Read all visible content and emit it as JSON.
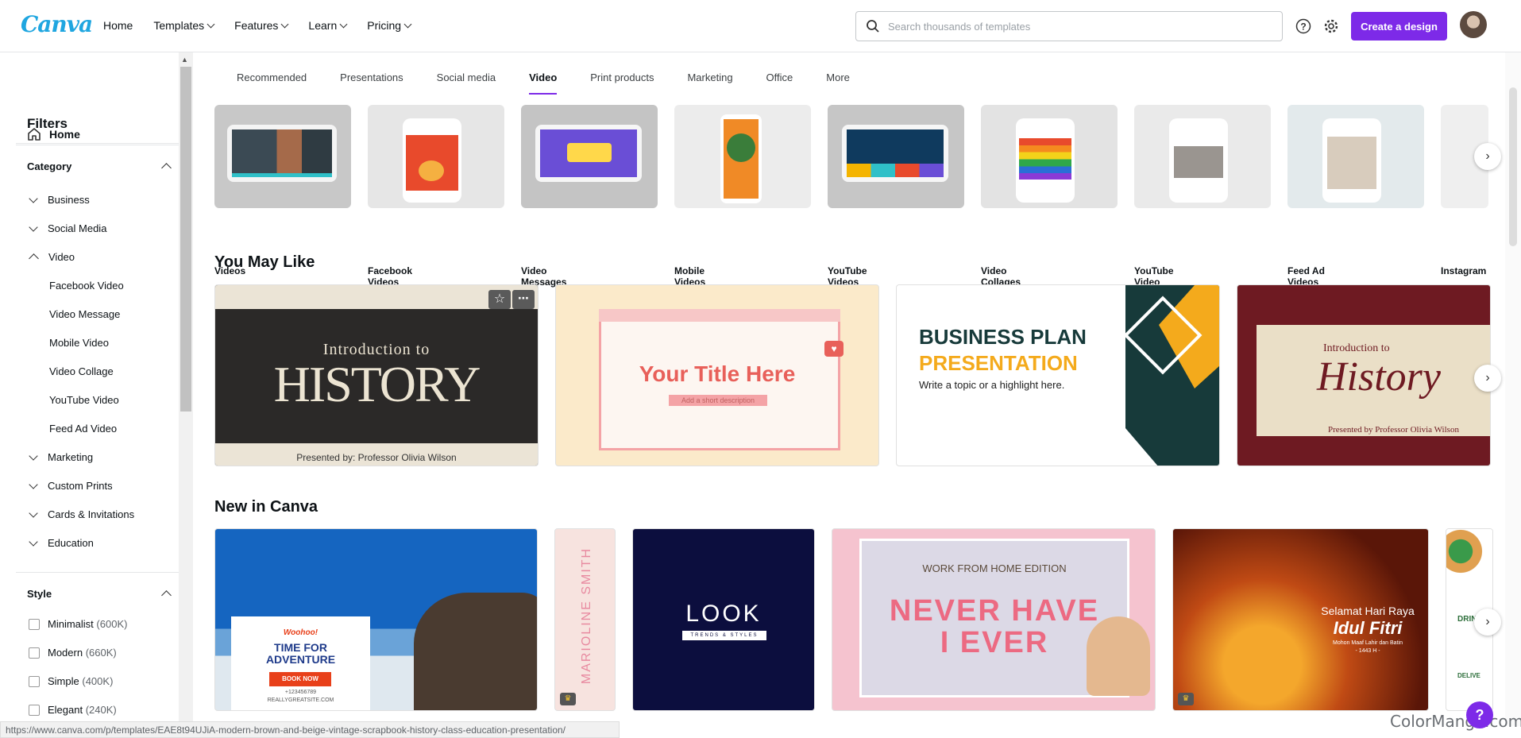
{
  "app": {
    "logo": "Canva"
  },
  "nav": {
    "home": "Home",
    "templates": "Templates",
    "features": "Features",
    "learn": "Learn",
    "pricing": "Pricing"
  },
  "search": {
    "placeholder": "Search thousands of templates"
  },
  "header": {
    "create_label": "Create a design"
  },
  "sidebar": {
    "home": "Home",
    "filters": "Filters",
    "category_title": "Category",
    "categories": [
      "Business",
      "Social Media",
      "Video"
    ],
    "video_sub": [
      "Facebook Video",
      "Video Message",
      "Mobile Video",
      "Video Collage",
      "YouTube Video",
      "Feed Ad Video"
    ],
    "more_categories": [
      "Marketing",
      "Custom Prints",
      "Cards & Invitations",
      "Education"
    ],
    "style_title": "Style",
    "styles": [
      {
        "name": "Minimalist",
        "count": "(600K)"
      },
      {
        "name": "Modern",
        "count": "(660K)"
      },
      {
        "name": "Simple",
        "count": "(400K)"
      },
      {
        "name": "Elegant",
        "count": "(240K)"
      }
    ]
  },
  "tabs": [
    "Recommended",
    "Presentations",
    "Social media",
    "Video",
    "Print products",
    "Marketing",
    "Office",
    "More"
  ],
  "active_tab": "Video",
  "video_types": [
    "Videos",
    "Facebook Videos",
    "Video Messages",
    "Mobile Videos",
    "YouTube Videos",
    "Video Collages",
    "YouTube Video Ads",
    "Feed Ad Videos (Portrait)",
    "Instagram"
  ],
  "you_may_like": {
    "title": "You May Like",
    "card1": {
      "line1": "Introduction to",
      "line2": "HISTORY",
      "byline": "Presented by: Professor Olivia Wilson"
    },
    "card2": {
      "title": "Your Title Here",
      "subtitle": "Add a short description"
    },
    "card3": {
      "line1": "BUSINESS PLAN",
      "line2": "PRESENTATION",
      "line3": "Write a topic or a highlight here."
    },
    "card4": {
      "line1": "Introduction to",
      "line2": "History",
      "byline": "Presented by Professor Olivia Wilson"
    }
  },
  "new_in_canva": {
    "title": "New in Canva",
    "card1": {
      "woohoo": "Woohoo!",
      "headline": "TIME FOR ADVENTURE",
      "button": "BOOK NOW",
      "phone": "+123456789",
      "site": "REALLYGREATSITE.COM"
    },
    "card2": {
      "name": "MARIOLINE SMITH"
    },
    "card3": {
      "logo": "LOOK",
      "tagline": "TRENDS & STYLES"
    },
    "card4": {
      "edition": "WORK FROM HOME EDITION",
      "title1": "NEVER HAVE",
      "title2": "I EVER"
    },
    "card5": {
      "line1": "Selamat Hari Raya",
      "line2": "Idul Fitri",
      "line3": "Mohon Maaf Lahir dan Batin",
      "line4": "- 1443 H -"
    },
    "card6": {
      "label": "DRIN",
      "label2": "DELIVE"
    }
  },
  "status": {
    "url": "https://www.canva.com/p/templates/EAE8t94UJiA-modern-brown-and-beige-vintage-scrapbook-history-class-education-presentation/"
  },
  "watermark": "ColorMango.com",
  "colors": {
    "brand": "#7d2ae8",
    "logo": "#1fa6e0"
  }
}
